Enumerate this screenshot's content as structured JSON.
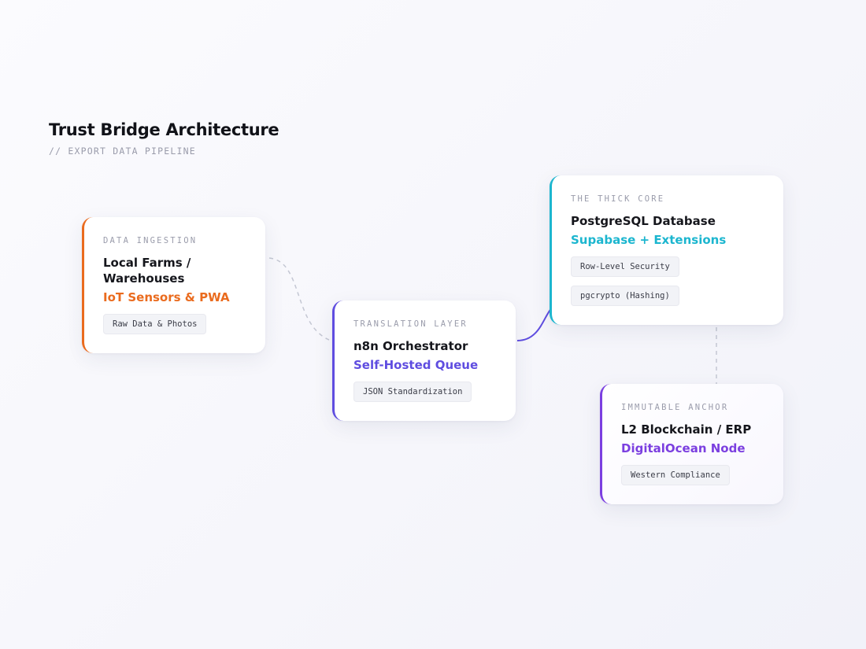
{
  "header": {
    "title": "Trust Bridge Architecture",
    "subtitle": "// EXPORT DATA PIPELINE"
  },
  "nodes": [
    {
      "id": "ingestion",
      "eyebrow": "DATA INGESTION",
      "heading": "Local Farms / Warehouses",
      "accent_text": "IoT Sensors & PWA",
      "accent_color": "#ea6b1e",
      "tags": [
        "Raw Data & Photos"
      ]
    },
    {
      "id": "translation",
      "eyebrow": "TRANSLATION LAYER",
      "heading": "n8n Orchestrator",
      "accent_text": "Self-Hosted Queue",
      "accent_color": "#5f4de0",
      "tags": [
        "JSON Standardization"
      ]
    },
    {
      "id": "core",
      "eyebrow": "THE THICK CORE",
      "heading": "PostgreSQL Database",
      "accent_text": "Supabase + Extensions",
      "accent_color": "#1cb6cf",
      "tags": [
        "Row-Level Security",
        "pgcrypto (Hashing)"
      ]
    },
    {
      "id": "anchor",
      "eyebrow": "IMMUTABLE ANCHOR",
      "heading": "L2 Blockchain / ERP",
      "accent_text": "DigitalOcean Node",
      "accent_color": "#7b3fe0",
      "tags": [
        "Western Compliance"
      ]
    }
  ],
  "edges": [
    {
      "from": "ingestion",
      "to": "translation",
      "style": "dashed"
    },
    {
      "from": "translation",
      "to": "core",
      "style": "solid"
    },
    {
      "from": "core",
      "to": "anchor",
      "style": "dashed"
    }
  ]
}
